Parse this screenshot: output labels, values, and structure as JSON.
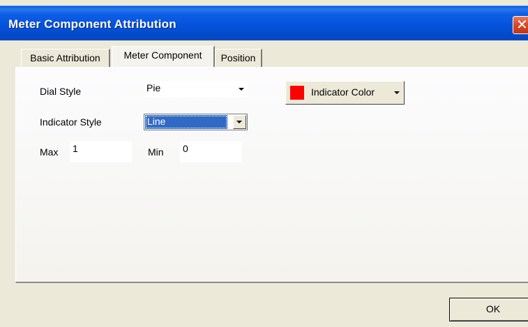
{
  "window": {
    "title": "Meter Component Attribution",
    "close_glyph": "✕"
  },
  "tabs": [
    {
      "label": "Basic Attribution",
      "active": false
    },
    {
      "label": "Meter Component",
      "active": true
    },
    {
      "label": "Position",
      "active": false
    }
  ],
  "form": {
    "dial_style": {
      "label": "Dial Style",
      "value": "Pie"
    },
    "indicator_style": {
      "label": "Indicator Style",
      "value": "Line"
    },
    "max": {
      "label": "Max",
      "value": "1"
    },
    "min": {
      "label": "Min",
      "value": "0"
    },
    "indicator_color": {
      "label": "Indicator Color",
      "color": "#ff0000"
    }
  },
  "footer": {
    "ok_label": "OK"
  },
  "colors": {
    "title_bar": "#0553dc",
    "selection": "#316ac5",
    "dialog_bg": "#ece9d8",
    "indicator_swatch": "#ff0000"
  },
  "icons": {
    "close": "close-icon",
    "dropdown": "chevron-down-icon"
  }
}
